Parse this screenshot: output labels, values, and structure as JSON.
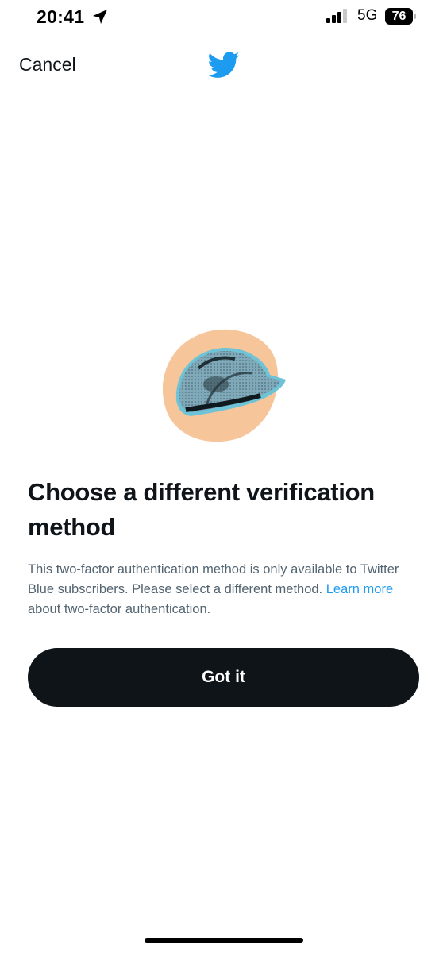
{
  "status_bar": {
    "time": "20:41",
    "network": "5G",
    "battery_level": "76",
    "icons": [
      "location-arrow-icon",
      "cellular-signal-icon",
      "battery-icon"
    ]
  },
  "nav": {
    "cancel_label": "Cancel",
    "logo_icon": "twitter-bird-icon",
    "logo_color": "#1d9bf0"
  },
  "illustration": {
    "icon": "hard-hat-illustration",
    "backdrop_color": "#f7c59a",
    "hat_color": "#7fa8b8"
  },
  "content": {
    "heading": "Choose a different verification method",
    "body_text": "This two-factor authentication method is only available to Twitter Blue subscribers. Please select a different method.",
    "learn_more_link": "Learn more",
    "learn_more_suffix": " about two-factor authentication.",
    "link_color": "#1d9bf0"
  },
  "actions": {
    "primary_label": "Got it",
    "primary_color": "#0f1419"
  }
}
